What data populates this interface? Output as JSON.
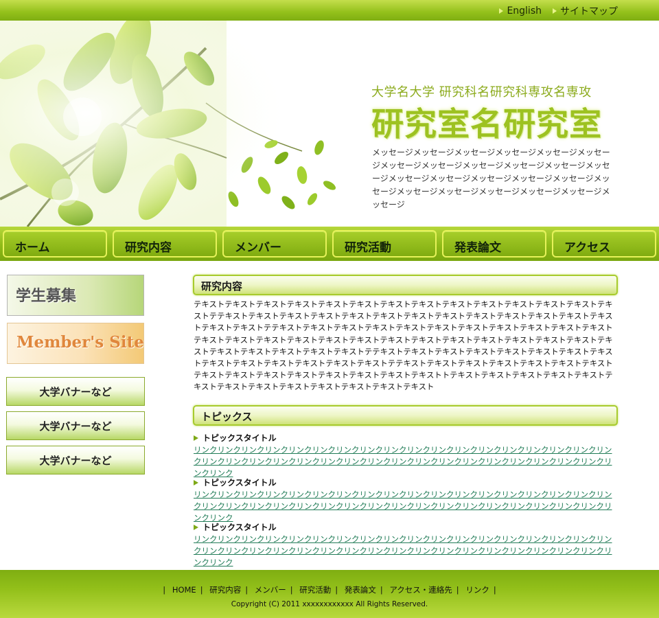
{
  "top_links": {
    "english": "English",
    "sitemap": "サイトマップ"
  },
  "header": {
    "subtitle": "大学名大学  研究科名研究科専攻名専攻",
    "title": "研究室名研究室",
    "message": "メッセージメッセージメッセージメッセージメッセージメッセージメッセージメッセージメッセージメッセージメッセージメッセージメッセージメッセージメッセージメッセージメッセージメッセージメッセージメッセージメッセージメッセージメッセージメッセージ"
  },
  "nav": {
    "home": "ホーム",
    "research": "研究内容",
    "members": "メンバー",
    "activities": "研究活動",
    "papers": "発表論文",
    "access": "アクセス"
  },
  "sidebar": {
    "recruit_banner": "学生募集",
    "member_banner": "Member's Site",
    "uni_banners": [
      "大学バナーなど",
      "大学バナーなど",
      "大学バナーなど"
    ]
  },
  "research": {
    "heading": "研究内容",
    "text": "テキストテキストテキストテキストテキストテキストテキストテキストテキストテキストテキストテキストテキストテキストテテキストテキストテキストテキストテキストテキストテキストテキストテキストテキストテキストテキストテキストテキストテキストテテキストテキストテキストテキストテキストテキストテキストテキストテキストテキストテキストテキストテキストテキストテキストテキストテキストテキストテキストテキストテキストテキストテキストテキストテキストテキストテキストテキストテキストテキストテテキストテキストテキストテキストテキストテキストテキストテキストテキストテキストテキストテキストテキストテキストテテキストテキストテキストテキストテキストテキストテキストテキストテキストテキストテキストテキストテキストテキストテキストトテキストテキストテキストテキストテキストテキストテキストテキストテキストテキストテキストテキストテキスト"
  },
  "topics": {
    "heading": "トピックス",
    "items": [
      {
        "title": "トピックスタイトル",
        "link": "リンクリンクリンクリンクリンクリンクリンクリンクリンクリンクリンクリンクリンクリンクリンクリンクリンクリンクリンクリンクリンクリンクリンクリンクリンクリンクリンクリンクリンクリンクリンクリンクリンクリンクリンクリンクリンク"
      },
      {
        "title": "トピックスタイトル",
        "link": "リンクリンクリンクリンクリンクリンクリンクリンクリンクリンクリンクリンクリンクリンクリンクリンクリンクリンクリンクリンクリンクリンクリンクリンクリンクリンクリンクリンクリンクリンクリンクリンクリンクリンクリンクリンクリンク"
      },
      {
        "title": "トピックスタイトル",
        "link": "リンクリンクリンクリンクリンクリンクリンクリンクリンクリンクリンクリンクリンクリンクリンクリンクリンクリンクリンクリンクリンクリンクリンクリンクリンクリンクリンクリンクリンクリンクリンクリンクリンクリンクリンクリンクリンク"
      }
    ]
  },
  "footer": {
    "links": [
      "HOME",
      "研究内容",
      "メンバー",
      "研究活動",
      "発表論文",
      "アクセス・連絡先",
      "リンク"
    ],
    "separator": "|",
    "copyright": "Copyright (C) 2011 xxxxxxxxxxxx All Rights Reserved."
  },
  "colors": {
    "brand_green": "#8fbb17",
    "title_green": "#9dc221",
    "link_color": "#217c57"
  }
}
